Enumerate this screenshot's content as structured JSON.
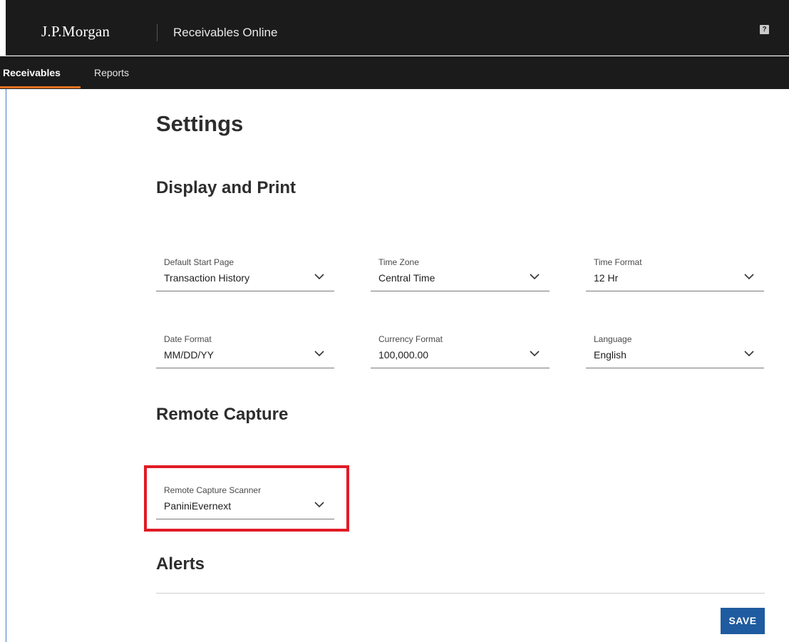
{
  "header": {
    "brand": "J.P.Morgan",
    "app_title": "Receivables Online",
    "help_glyph": "?"
  },
  "nav": {
    "tabs": [
      {
        "label": "Receivables",
        "active": true
      },
      {
        "label": "Reports",
        "active": false
      }
    ],
    "accent_color": "#e37222"
  },
  "page": {
    "title": "Settings"
  },
  "display_print": {
    "heading": "Display and Print",
    "fields": [
      {
        "label": "Default Start Page",
        "value": "Transaction History"
      },
      {
        "label": "Time Zone",
        "value": "Central Time"
      },
      {
        "label": "Time Format",
        "value": "12 Hr"
      },
      {
        "label": "Date Format",
        "value": "MM/DD/YY"
      },
      {
        "label": "Currency Format",
        "value": "100,000.00"
      },
      {
        "label": "Language",
        "value": "English"
      }
    ]
  },
  "remote_capture": {
    "heading": "Remote Capture",
    "scanner": {
      "label": "Remote Capture Scanner",
      "value": "PaniniEvernext"
    },
    "highlight_color": "#e01b24"
  },
  "alerts": {
    "heading": "Alerts"
  },
  "actions": {
    "save_label": "SAVE",
    "save_color": "#1f5ba0"
  },
  "icons": {
    "dropdown": "chevron-down-icon",
    "help": "help-icon",
    "user": "user-icon"
  }
}
